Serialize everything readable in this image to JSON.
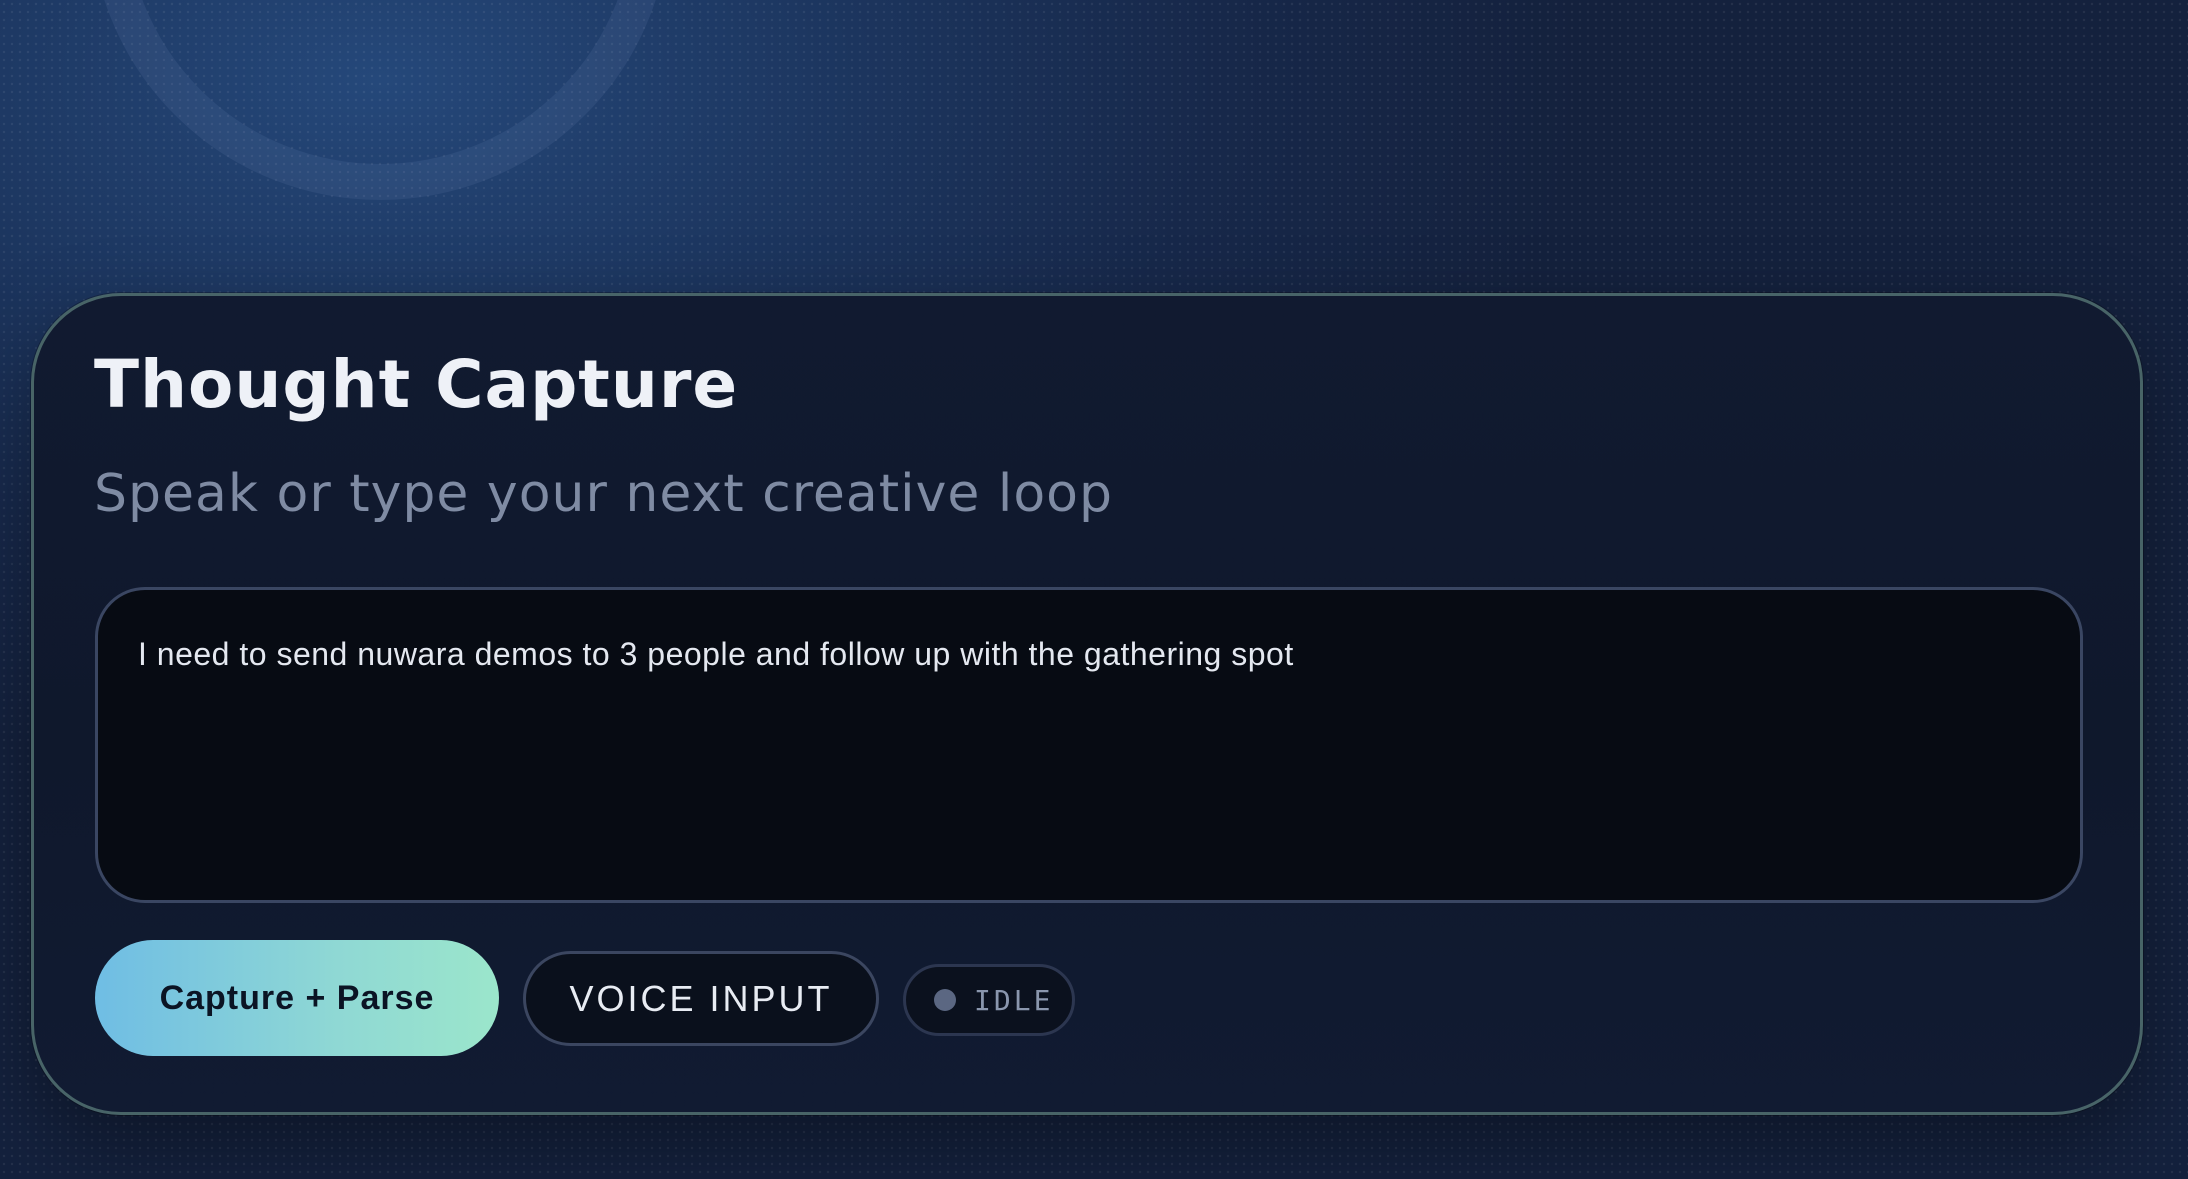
{
  "card": {
    "title": "Thought Capture",
    "subtitle": "Speak or type your next creative loop",
    "input": {
      "value": "I need to send nuwara demos to 3 people and follow up with the gathering spot"
    },
    "buttons": {
      "capture_label": "Capture + Parse",
      "voice_label": "VOICE INPUT"
    },
    "status": {
      "label": "IDLE",
      "icon": "status-dot-icon"
    }
  },
  "colors": {
    "accent_start": "#6fbde4",
    "accent_end": "#9be6cb",
    "background": "#14213d",
    "card": "#111a30",
    "status_dot": "#5b6782"
  }
}
